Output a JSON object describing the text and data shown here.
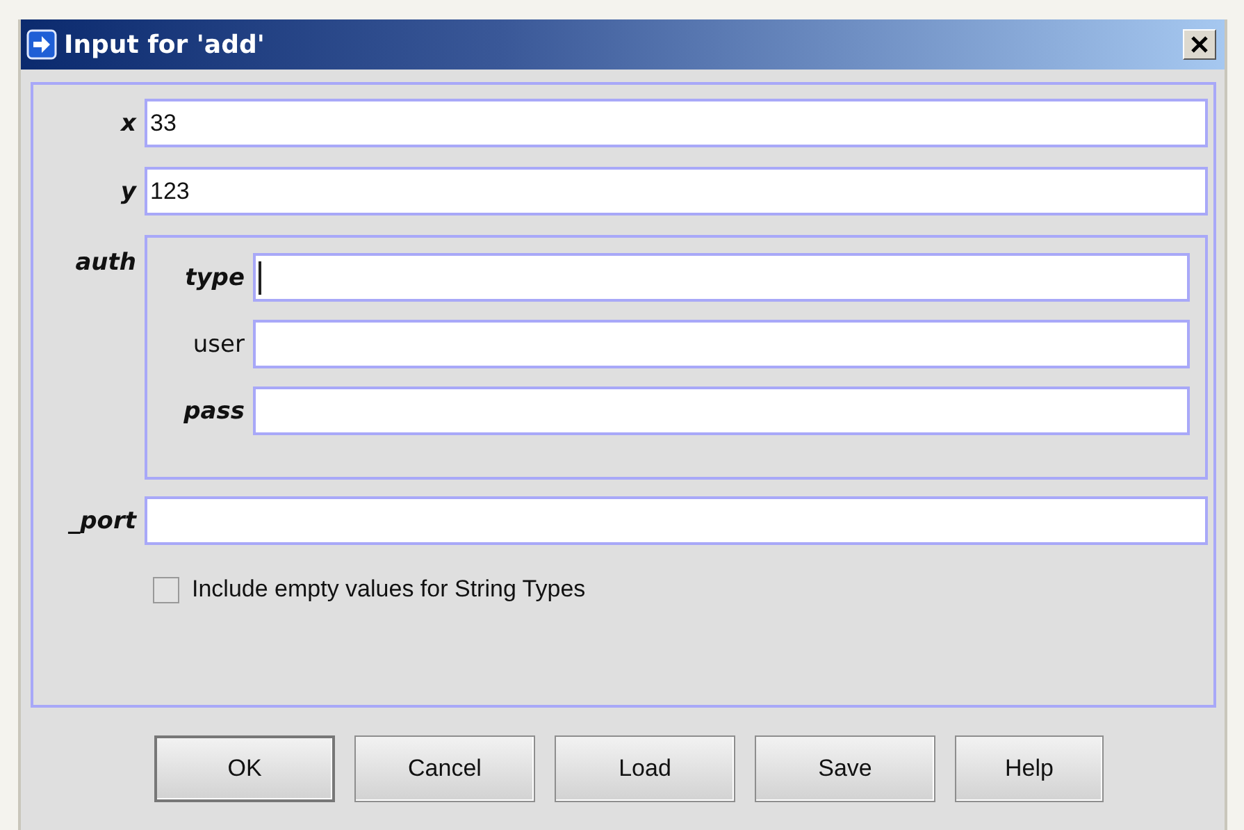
{
  "window": {
    "title": "Input for 'add'"
  },
  "fields": [
    {
      "kind": "text",
      "label": "x",
      "required": true,
      "value": "33",
      "focused": false
    },
    {
      "kind": "text",
      "label": "y",
      "required": true,
      "value": "123",
      "focused": false
    },
    {
      "kind": "group",
      "label": "auth",
      "required": true,
      "children": [
        {
          "kind": "text",
          "label": "type",
          "required": true,
          "focused": true
        },
        {
          "kind": "text",
          "label": "user",
          "required": false,
          "focused": false
        },
        {
          "kind": "text",
          "label": "pass",
          "required": true,
          "focused": false
        }
      ]
    },
    {
      "kind": "text",
      "label": "_port",
      "required": true,
      "focused": false
    }
  ],
  "option": {
    "label": "Include empty values for String Types",
    "checked": false
  },
  "buttons": [
    {
      "label": "OK",
      "default": true
    },
    {
      "label": "Cancel",
      "default": false
    },
    {
      "label": "Load",
      "default": false
    },
    {
      "label": "Save",
      "default": false
    },
    {
      "label": "Help",
      "default": false
    }
  ]
}
